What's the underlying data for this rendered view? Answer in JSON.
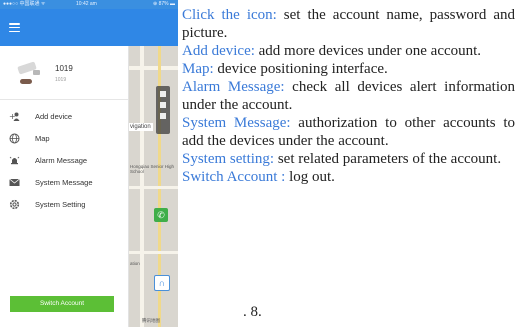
{
  "status_bar": {
    "carrier": "●●●○○ 中国联通 ᯤ",
    "time": "10:42 am",
    "battery": "⊕ 87% ▬"
  },
  "drawer": {
    "menu_icon": "hamburger-menu-icon",
    "profile": {
      "name": "1019",
      "subtitle": "1019"
    },
    "items": [
      {
        "label": "Add device",
        "icon": "add-user-icon"
      },
      {
        "label": "Map",
        "icon": "globe-icon"
      },
      {
        "label": "Alarm Message",
        "icon": "alarm-icon"
      },
      {
        "label": "System Message",
        "icon": "envelope-icon"
      },
      {
        "label": "System Setting",
        "icon": "gear-icon"
      }
    ],
    "switch_account_label": "Switch Account"
  },
  "map": {
    "navigation_label": "vigation",
    "poi_text": "Hongqiao Senior High School",
    "bottom_text": "腾讯地图",
    "side_text": "ation"
  },
  "descriptions": [
    {
      "keyword": "Click the icon:",
      "text": " set the account name, password and  picture."
    },
    {
      "keyword": "Add device:",
      "text": " add  more devices under one account."
    },
    {
      "keyword": "Map:",
      "text": " device positioning interface."
    },
    {
      "keyword": "Alarm Message:",
      "text": " check  all devices alert information under the account."
    },
    {
      "keyword": "System Message:",
      "text": " authorization to other accounts to add the devices under the account."
    },
    {
      "keyword": "System setting:",
      "text": " set  related parameters of the account."
    },
    {
      "keyword": "Switch Account :",
      "text": " log out."
    }
  ],
  "page_number": ". 8.",
  "colors": {
    "topbar": "#2f87e6",
    "keyword": "#3a7ad8",
    "switch_button": "#5cbf36"
  }
}
